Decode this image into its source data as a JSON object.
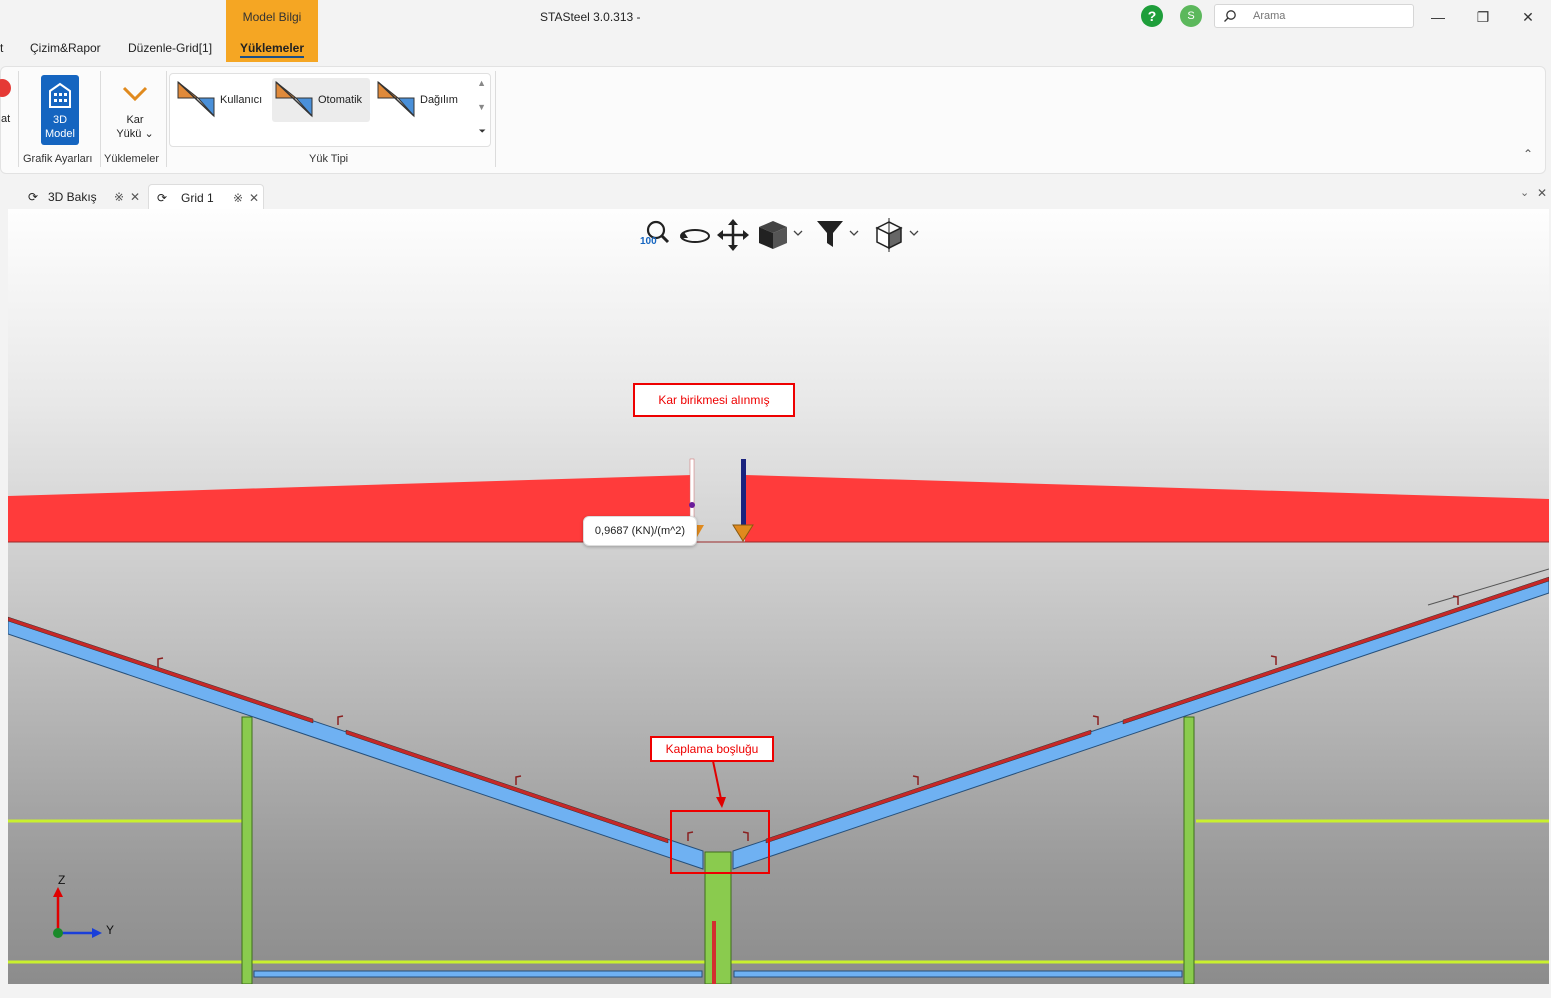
{
  "titlebar": {
    "context_tab_header": "Model Bilgi",
    "app_title": "STASteel 3.0.313 -",
    "help_label": "?",
    "avatar_initial": "S",
    "search_placeholder": "Arama",
    "minimize": "—",
    "restore": "❐",
    "close": "✕"
  },
  "ribbon_tabs": [
    {
      "label": "t"
    },
    {
      "label": "Çizim&Rapor"
    },
    {
      "label": "Düzenle-Grid[1]"
    },
    {
      "label": "Yüklemeler",
      "active": true
    }
  ],
  "ribbon": {
    "cancel_label": "at",
    "model3d": {
      "line1": "3D",
      "line2": "Model"
    },
    "kar": {
      "line1": "Kar",
      "line2": "Yükü"
    },
    "groups": {
      "grafik": "Grafik Ayarları",
      "yuklemeler": "Yüklemeler",
      "yuk_tipi": "Yük Tipi"
    },
    "gallery": [
      {
        "label": "Kullanıcı",
        "selected": false
      },
      {
        "label": "Otomatik",
        "selected": true
      },
      {
        "label": "Dağılım",
        "selected": false
      }
    ]
  },
  "doc_tabs": [
    {
      "label": "3D Bakış",
      "active": false
    },
    {
      "label": "Grid 1",
      "active": true
    }
  ],
  "viewport": {
    "zoom_label": "100",
    "tooltip_value": "0,9687 (KN)/(m^2)",
    "annotation_top": "Kar birikmesi alınmış",
    "annotation_bottom": "Kaplama boşluğu",
    "axis_z": "Z",
    "axis_y": "Y"
  },
  "colors": {
    "accent_orange": "#f5a623",
    "snow_load": "#ff3b3b",
    "rafter": "#6fb1f2",
    "column": "#8acb4e",
    "girt": "#c9f02f",
    "annotation_red": "#e00000",
    "ribbon_blue": "#1565c0"
  },
  "icons": {
    "search": "search-icon",
    "help": "help-icon",
    "zoom": "zoom-icon",
    "rotate": "rotate-icon",
    "pan": "pan-icon",
    "cube": "view-cube-icon",
    "filter": "filter-icon",
    "axes": "axes-icon"
  }
}
